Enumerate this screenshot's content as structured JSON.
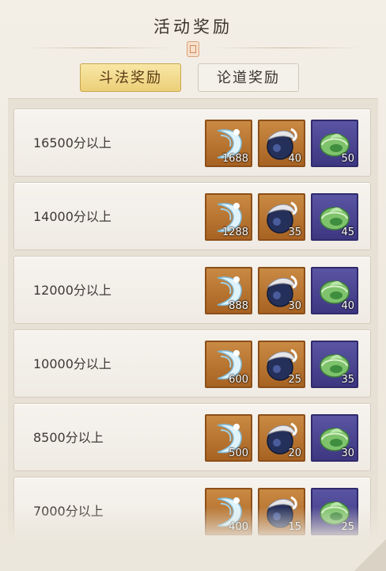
{
  "header": {
    "title": "活动奖励"
  },
  "tabs": [
    {
      "label": "斗法奖励",
      "active": true
    },
    {
      "label": "论道奖励",
      "active": false
    }
  ],
  "rewards": [
    {
      "label": "16500分以上",
      "items": [
        {
          "icon": "crescent-crystal-icon",
          "qty": "1688"
        },
        {
          "icon": "dark-orb-icon",
          "qty": "40"
        },
        {
          "icon": "jade-ring-icon",
          "qty": "50"
        }
      ]
    },
    {
      "label": "14000分以上",
      "items": [
        {
          "icon": "crescent-crystal-icon",
          "qty": "1288"
        },
        {
          "icon": "dark-orb-icon",
          "qty": "35"
        },
        {
          "icon": "jade-ring-icon",
          "qty": "45"
        }
      ]
    },
    {
      "label": "12000分以上",
      "items": [
        {
          "icon": "crescent-crystal-icon",
          "qty": "888"
        },
        {
          "icon": "dark-orb-icon",
          "qty": "30"
        },
        {
          "icon": "jade-ring-icon",
          "qty": "40"
        }
      ]
    },
    {
      "label": "10000分以上",
      "items": [
        {
          "icon": "crescent-crystal-icon",
          "qty": "600"
        },
        {
          "icon": "dark-orb-icon",
          "qty": "25"
        },
        {
          "icon": "jade-ring-icon",
          "qty": "35"
        }
      ]
    },
    {
      "label": "8500分以上",
      "items": [
        {
          "icon": "crescent-crystal-icon",
          "qty": "500"
        },
        {
          "icon": "dark-orb-icon",
          "qty": "20"
        },
        {
          "icon": "jade-ring-icon",
          "qty": "30"
        }
      ]
    },
    {
      "label": "7000分以上",
      "items": [
        {
          "icon": "crescent-crystal-icon",
          "qty": "400"
        },
        {
          "icon": "dark-orb-icon",
          "qty": "15"
        },
        {
          "icon": "jade-ring-icon",
          "qty": "25"
        }
      ]
    }
  ],
  "colors": {
    "gold_frame": "#b06d2c",
    "purple_frame": "#4a4494",
    "active_tab": "#efd67f"
  }
}
